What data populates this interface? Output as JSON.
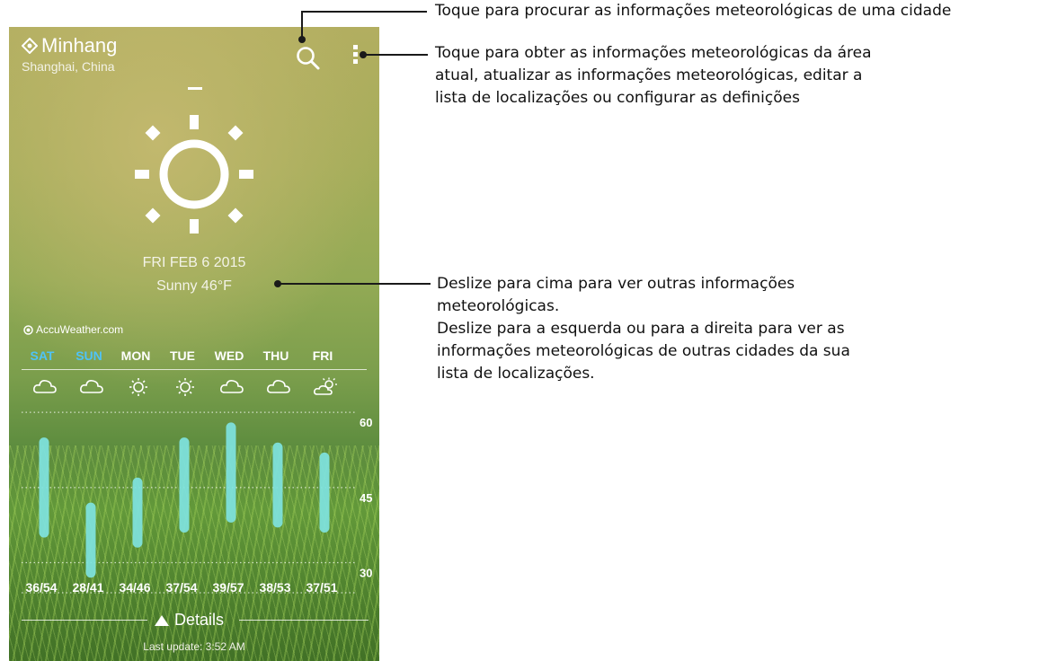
{
  "header": {
    "city": "Minhang",
    "region": "Shanghai, China"
  },
  "current": {
    "date": "FRI FEB 6 2015",
    "condition": "Sunny 46°F"
  },
  "provider": "AccuWeather.com",
  "forecast": {
    "days": [
      "SAT",
      "SUN",
      "MON",
      "TUE",
      "WED",
      "THU",
      "FRI"
    ],
    "day_colors": [
      "#4fc3f7",
      "#4fc3f7",
      "#ffffff",
      "#ffffff",
      "#ffffff",
      "#ffffff",
      "#ffffff"
    ],
    "icons": [
      "cloudy-icon",
      "cloudy-icon",
      "sunny-icon",
      "sunny-icon",
      "cloudy-icon",
      "cloudy-icon",
      "partly-sunny-icon"
    ],
    "temps": [
      "36/54",
      "28/41",
      "34/46",
      "37/54",
      "39/57",
      "38/53",
      "37/51"
    ]
  },
  "chart_data": {
    "type": "bar",
    "categories": [
      "SAT",
      "SUN",
      "MON",
      "TUE",
      "WED",
      "THU",
      "FRI"
    ],
    "low": [
      36,
      28,
      34,
      37,
      39,
      38,
      37
    ],
    "high": [
      54,
      41,
      46,
      54,
      57,
      53,
      51
    ],
    "yticks": [
      "60",
      "45",
      "30"
    ],
    "ylim": [
      24,
      62
    ],
    "bar_color": "#7fe3e0"
  },
  "footer": {
    "details_label": "Details",
    "last_update": "Last update: 3:52 AM"
  },
  "callouts": {
    "search": "Toque para procurar as informações meteorológicas de uma cidade",
    "menu": [
      "Toque para obter as informações meteorológicas da área",
      "atual, atualizar as informações meteorológicas, editar a",
      "lista de localizações ou configurar as definições"
    ],
    "swipe": [
      "Deslize para cima para ver outras informações",
      "meteorológicas.",
      "Deslize para a esquerda ou para a direita para ver as",
      "informações meteorológicas de outras cidades da sua",
      "lista de localizações."
    ]
  }
}
